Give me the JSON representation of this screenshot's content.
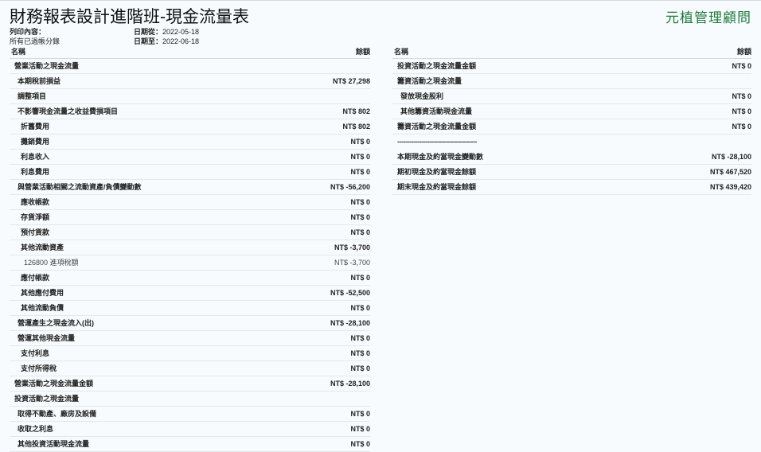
{
  "report": {
    "title": "財務報表設計進階班-現金流量表",
    "brand": "元植管理顧問",
    "print_content_label": "列印內容：",
    "print_content_value": "所有已過帳分錄",
    "date_from_label": "日期從：",
    "date_from": "2022-05-18",
    "date_to_label": "日期至：",
    "date_to": "2022-06-18"
  },
  "columns": {
    "name": "名稱",
    "balance": "餘額"
  },
  "left_rows": [
    {
      "name": "營業活動之現金流量",
      "value": "",
      "level": 0
    },
    {
      "name": "本期稅前損益",
      "value": "NT$ 27,298",
      "level": 1
    },
    {
      "name": "調整項目",
      "value": "",
      "level": 1
    },
    {
      "name": "不影響現金流量之收益費損項目",
      "value": "NT$ 802",
      "level": 1
    },
    {
      "name": "折舊費用",
      "value": "NT$ 802",
      "level": 2
    },
    {
      "name": "攤銷費用",
      "value": "NT$ 0",
      "level": 2
    },
    {
      "name": "利息收入",
      "value": "NT$ 0",
      "level": 2
    },
    {
      "name": "利息費用",
      "value": "NT$ 0",
      "level": 2
    },
    {
      "name": "與營業活動相關之流動資產/負債變動數",
      "value": "NT$ -56,200",
      "level": 1
    },
    {
      "name": "應收帳款",
      "value": "NT$ 0",
      "level": 2
    },
    {
      "name": "存貨淨額",
      "value": "NT$ 0",
      "level": 2
    },
    {
      "name": "預付貨款",
      "value": "NT$ 0",
      "level": 2
    },
    {
      "name": "其他流動資產",
      "value": "NT$ -3,700",
      "level": 2
    },
    {
      "name": "126800 進項稅額",
      "value": "NT$ -3,700",
      "level": 3
    },
    {
      "name": "應付帳款",
      "value": "NT$ 0",
      "level": 2
    },
    {
      "name": "其他應付費用",
      "value": "NT$ -52,500",
      "level": 2
    },
    {
      "name": "其他流動負債",
      "value": "NT$ 0",
      "level": 2
    },
    {
      "name": "營運產生之現金流入(出)",
      "value": "NT$ -28,100",
      "level": 1
    },
    {
      "name": "營運其他現金流量",
      "value": "NT$ 0",
      "level": 1
    },
    {
      "name": "支付利息",
      "value": "NT$ 0",
      "level": 2
    },
    {
      "name": "支付所得稅",
      "value": "NT$ 0",
      "level": 2
    },
    {
      "name": "營業活動之現金流量金額",
      "value": "NT$ -28,100",
      "level": 0
    },
    {
      "name": "投資活動之現金流量",
      "value": "",
      "level": 0
    },
    {
      "name": "取得不動產、廠房及設備",
      "value": "NT$ 0",
      "level": 1
    },
    {
      "name": "收取之利息",
      "value": "NT$ 0",
      "level": 1
    },
    {
      "name": "其他投資活動現金流量",
      "value": "NT$ 0",
      "level": 1
    }
  ],
  "right_rows": [
    {
      "name": "投資活動之現金流量金額",
      "value": "NT$ 0",
      "level": 0
    },
    {
      "name": "籌資活動之現金流量",
      "value": "",
      "level": 0
    },
    {
      "name": "發放現金股利",
      "value": "NT$ 0",
      "level": 1
    },
    {
      "name": "其他籌資活動現金流量",
      "value": "NT$ 0",
      "level": 1
    },
    {
      "name": "籌資活動之現金流量金額",
      "value": "NT$ 0",
      "level": 0
    },
    {
      "name": "----------------------------------------",
      "value": "",
      "level": 0,
      "dash": true
    },
    {
      "name": "本期現金及約當現金變動數",
      "value": "NT$ -28,100",
      "level": 0
    },
    {
      "name": "期初現金及約當現金餘額",
      "value": "NT$ 467,520",
      "level": 0
    },
    {
      "name": "期末現金及約當現金餘額",
      "value": "NT$ 439,420",
      "level": 0
    }
  ]
}
